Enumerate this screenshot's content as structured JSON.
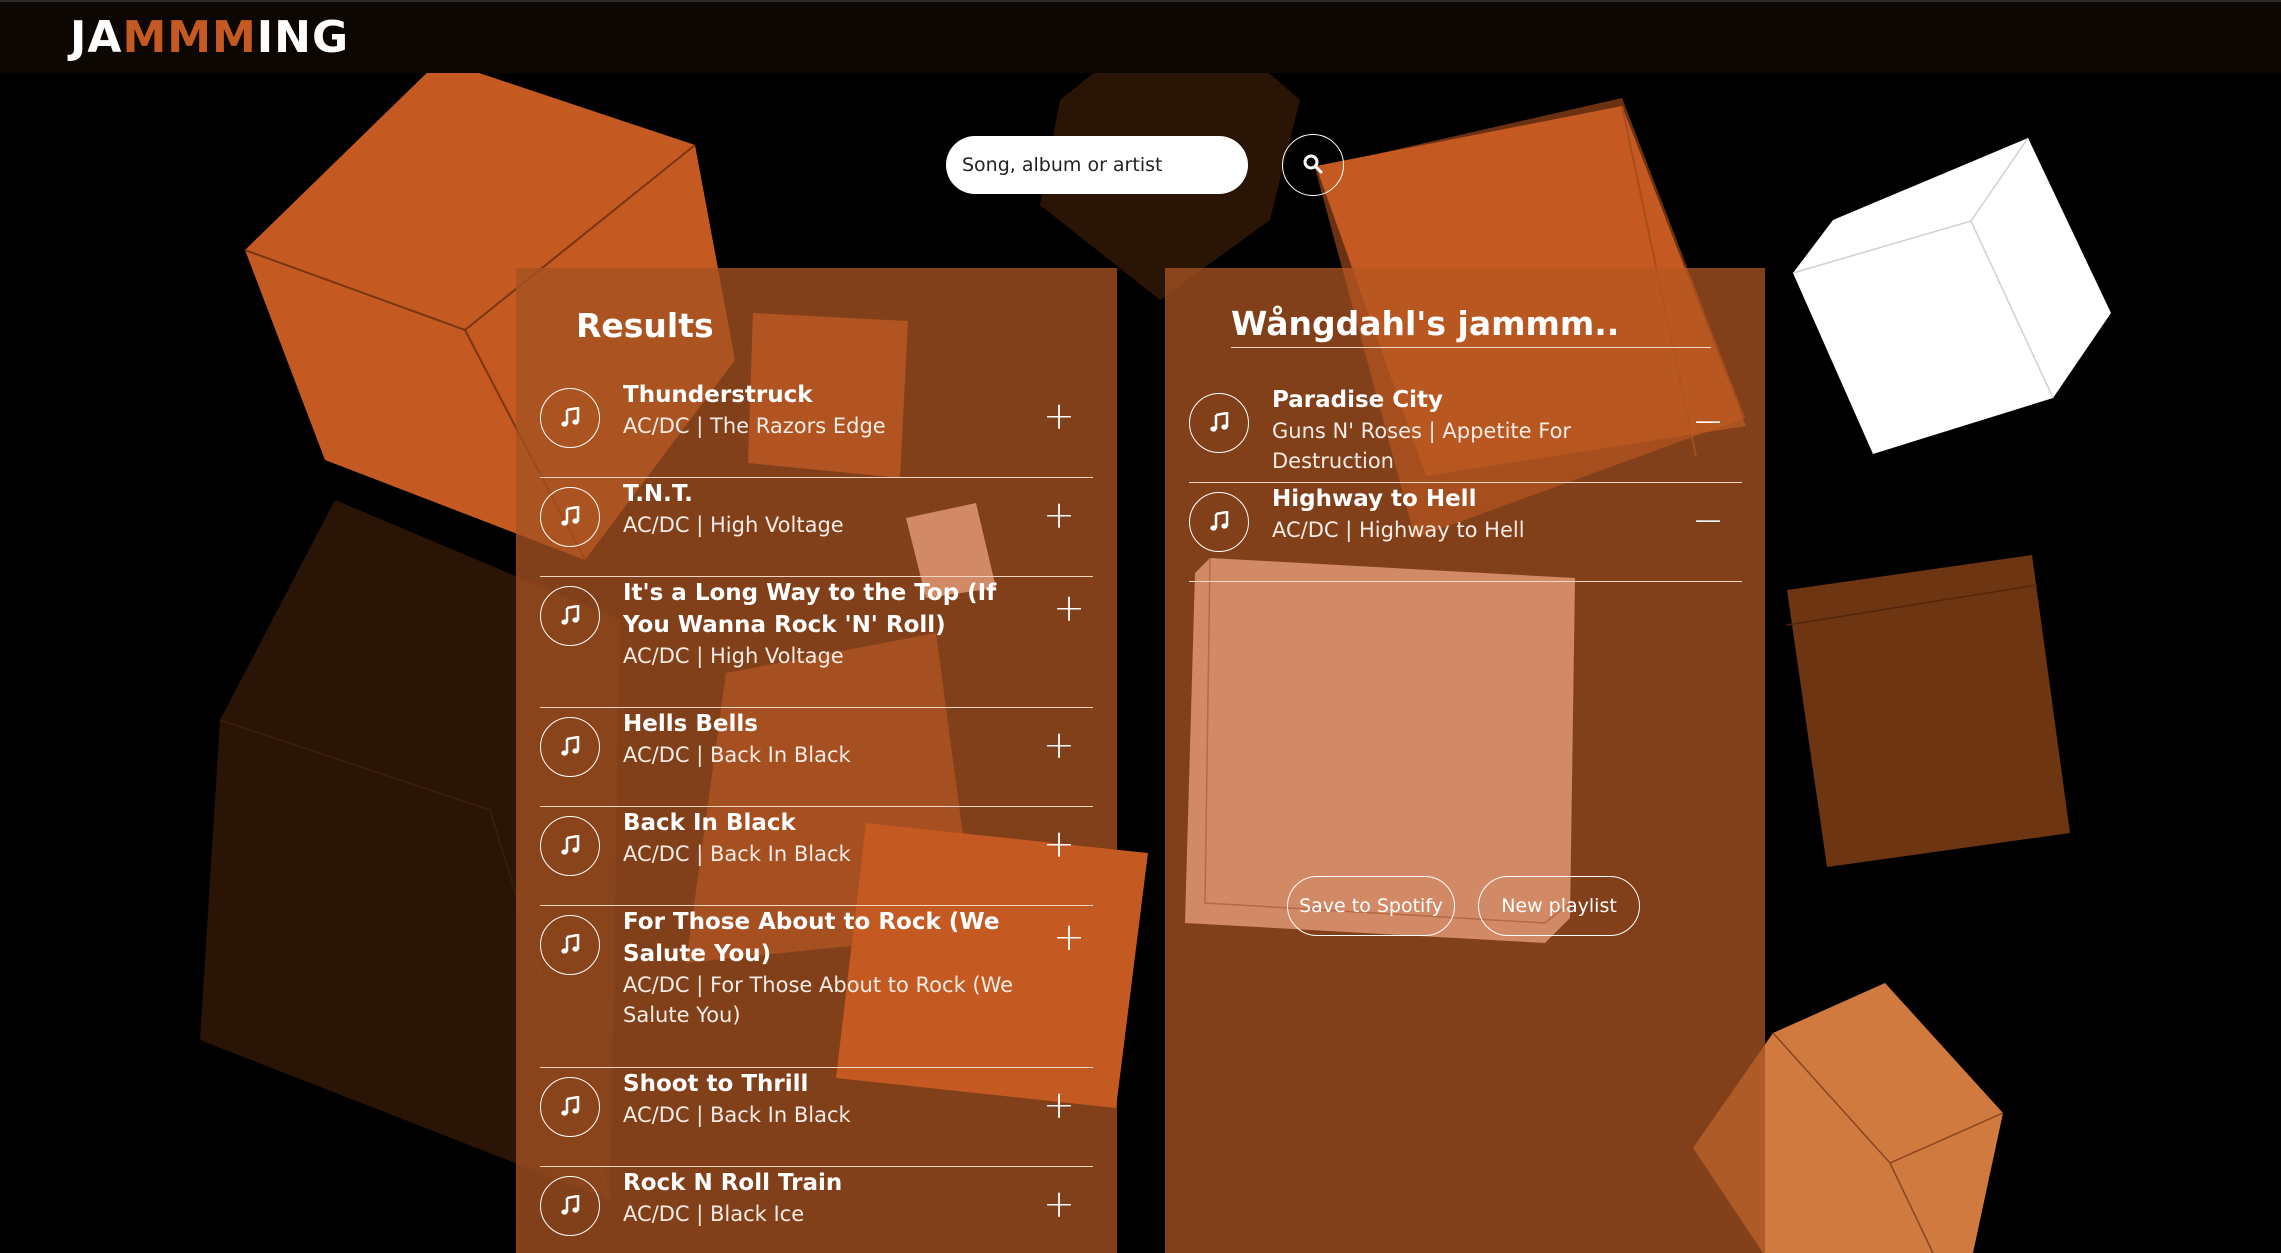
{
  "app": {
    "logo_a": "JA",
    "logo_b": "MMM",
    "logo_c": "ING"
  },
  "search": {
    "placeholder": "Song, album or artist",
    "button_icon": "search-icon"
  },
  "results": {
    "title": "Results",
    "tracks": [
      {
        "name": "Thunderstruck",
        "info": "AC/DC | The Razors Edge"
      },
      {
        "name": "T.N.T.",
        "info": "AC/DC | High Voltage"
      },
      {
        "name": "It's a Long Way to the Top (If You Wanna Rock 'N' Roll)",
        "info": "AC/DC | High Voltage"
      },
      {
        "name": "Hells Bells",
        "info": "AC/DC | Back In Black"
      },
      {
        "name": "Back In Black",
        "info": "AC/DC | Back In Black"
      },
      {
        "name": "For Those About to Rock (We Salute You)",
        "info": "AC/DC | For Those About to Rock (We Salute You)"
      },
      {
        "name": "Shoot to Thrill",
        "info": "AC/DC | Back In Black"
      },
      {
        "name": "Rock N Roll Train",
        "info": "AC/DC | Black Ice"
      }
    ],
    "action_symbol": "+"
  },
  "playlist": {
    "title": "Wångdahl's jammm..",
    "tracks": [
      {
        "name": "Paradise City",
        "info": "Guns N' Roses | Appetite For Destruction"
      },
      {
        "name": "Highway to Hell",
        "info": "AC/DC | Highway to Hell"
      }
    ],
    "action_symbol": "−",
    "save_label": "Save to Spotify",
    "new_label": "New playlist"
  },
  "colors": {
    "accent": "#c45a22",
    "panel": "#a55221",
    "background": "#000000"
  }
}
